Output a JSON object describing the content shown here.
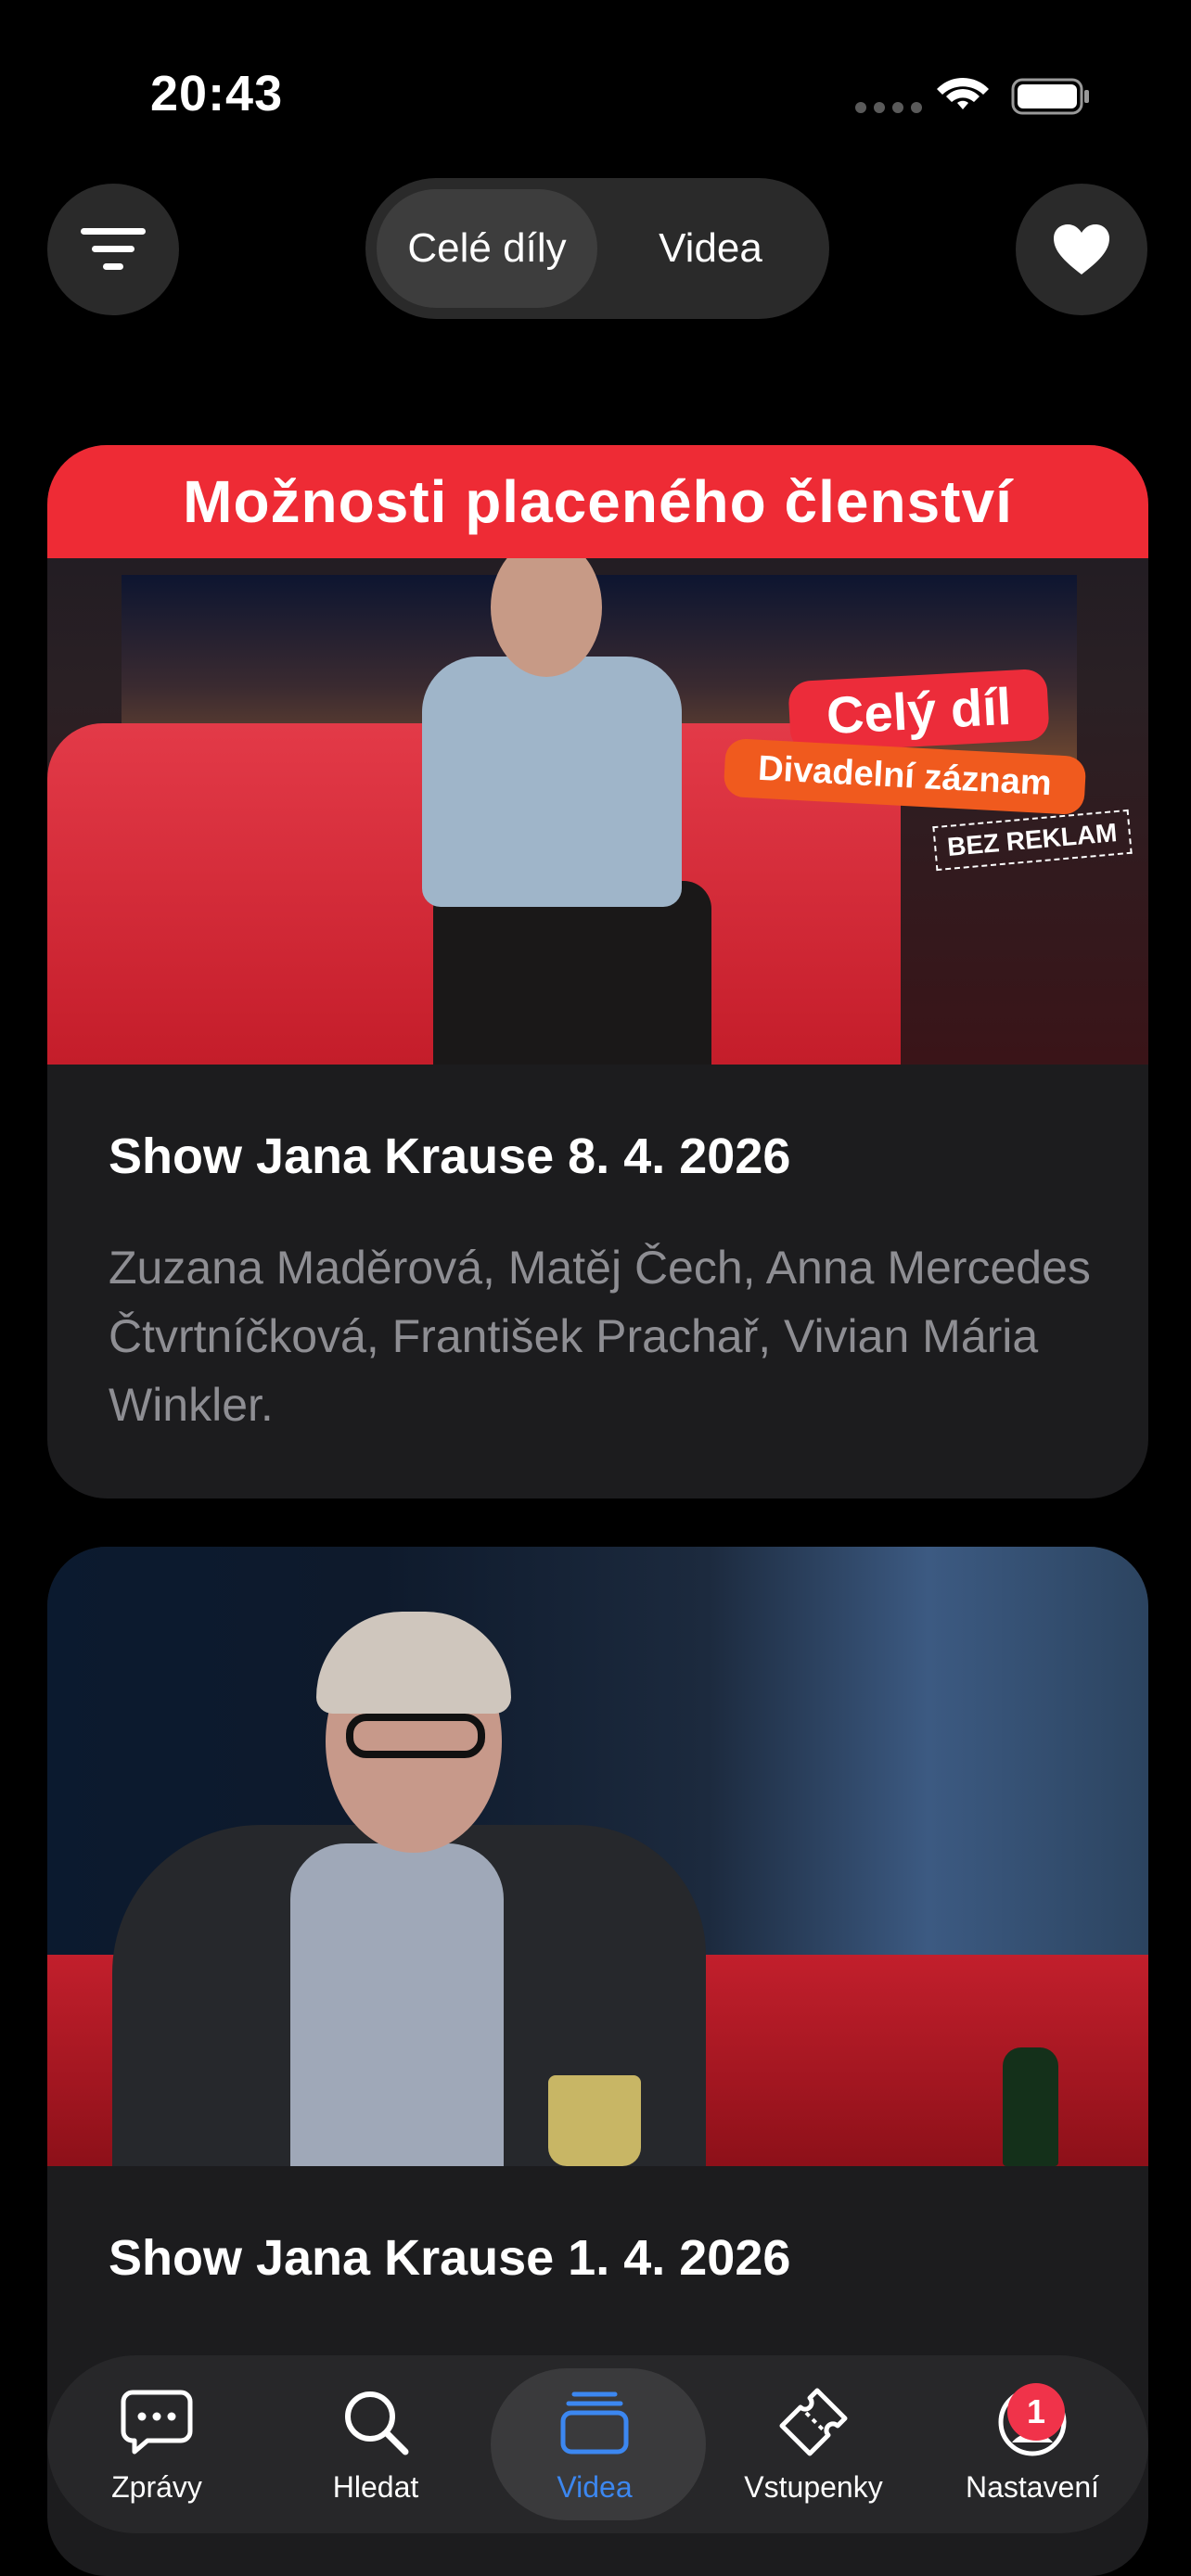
{
  "status_bar": {
    "time": "20:43"
  },
  "top_bar": {
    "segments": [
      "Celé díly",
      "Videa"
    ],
    "selected_segment": "Celé díly"
  },
  "episodes": [
    {
      "thumbnail": {
        "banner": "Možnosti placeného členství",
        "badge_primary": "Celý díl",
        "badge_secondary": "Divadelní záznam",
        "badge_tertiary": "BEZ REKLAM"
      },
      "title": "Show Jana Krause 8. 4. 2026",
      "description": "Zuzana Maděrová, Matěj Čech, Anna Mercedes Čtvrtníčková, František Prachař, Vivian Mária Winkler."
    },
    {
      "title": "Show Jana Krause 1. 4. 2026"
    }
  ],
  "tab_bar": {
    "items": [
      {
        "label": "Zprávy",
        "icon": "chat-bubble-icon"
      },
      {
        "label": "Hledat",
        "icon": "search-icon"
      },
      {
        "label": "Videa",
        "icon": "video-stack-icon"
      },
      {
        "label": "Vstupenky",
        "icon": "ticket-icon"
      },
      {
        "label": "Nastavení",
        "icon": "profile-icon"
      }
    ],
    "active": "Videa",
    "badge_count": "1"
  },
  "colors": {
    "background": "#000000",
    "card": "#1c1c1e",
    "accent": "#3c87f0",
    "badge": "#f0334a",
    "secondary_text": "#8e8e93"
  }
}
